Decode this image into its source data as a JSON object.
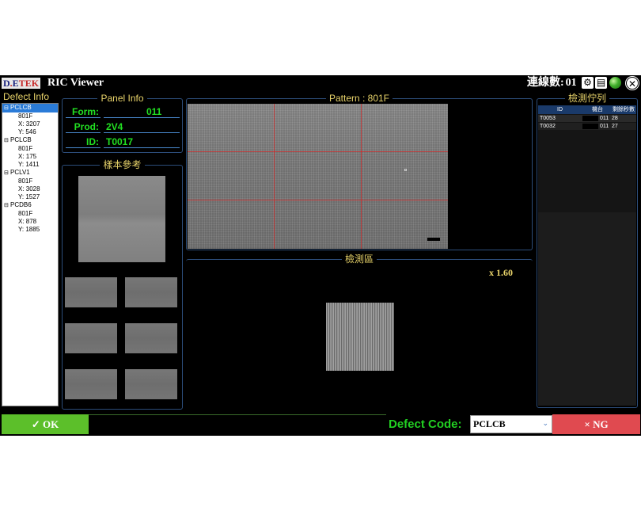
{
  "titlebar": {
    "logo": {
      "d": "D",
      "e": "E",
      "tek": "TEK"
    },
    "app_title": "RIC Viewer",
    "connections_label": "連線數:",
    "connections_value": "01",
    "icons": [
      "settings-icon",
      "document-icon",
      "status-light-icon",
      "close-icon"
    ]
  },
  "defect_info": {
    "title": "Defect Info",
    "tree": [
      {
        "code": "PCLCB",
        "selected": true,
        "children": [
          "801F",
          "X: 3207",
          "Y: 546"
        ]
      },
      {
        "code": "PCLCB",
        "selected": false,
        "children": [
          "801F",
          "X: 175",
          "Y: 1411"
        ]
      },
      {
        "code": "PCLV1",
        "selected": false,
        "children": [
          "801F",
          "X: 3028",
          "Y: 1527"
        ]
      },
      {
        "code": "PCDB6",
        "selected": false,
        "children": [
          "801F",
          "X: 878",
          "Y: 1885"
        ]
      }
    ]
  },
  "panel_info": {
    "title": "Panel Info",
    "form_label": "Form:",
    "form_value": "011",
    "prod_label": "Prod:",
    "prod_value": "2V4",
    "id_label": "ID:",
    "id_value": "T0017"
  },
  "sample": {
    "title": "樣本參考"
  },
  "pattern": {
    "title": "Pattern : 801F"
  },
  "inspect": {
    "title": "檢測區",
    "zoom": "x 1.60"
  },
  "queue": {
    "title": "檢測佇列",
    "headers": {
      "id": "ID",
      "machine": "機台",
      "count": "剩餘秒數"
    },
    "rows": [
      {
        "id": "T0053",
        "machine": "011",
        "count": "28"
      },
      {
        "id": "T0032",
        "machine": "011",
        "count": "27"
      }
    ]
  },
  "bottom": {
    "ok_label": "✓ OK",
    "defect_code_label": "Defect Code:",
    "defect_code_value": "PCLCB",
    "ng_label": "× NG"
  },
  "colors": {
    "label_green": "#22e022",
    "title_yellow": "#e8d36a",
    "ok_green": "#5cbf2a",
    "ng_red": "#e04a50",
    "border_blue": "#2c4d7a"
  }
}
